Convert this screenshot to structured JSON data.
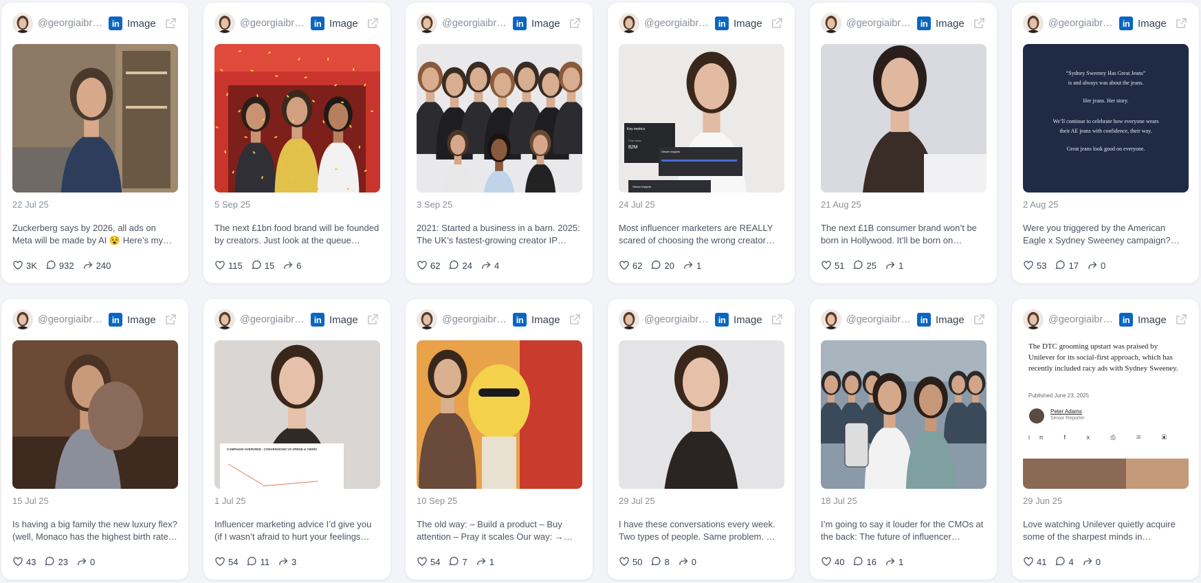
{
  "cards": [
    {
      "handle": "@georgiaibrahim",
      "type": "Image",
      "date": "22 Jul 25",
      "caption": "Zuckerberg says by 2026, all ads on Meta will be made by AI 😵 Here’s my hot take…",
      "likes": "3K",
      "comments": "932",
      "shares": "240"
    },
    {
      "handle": "@georgiaibrahim",
      "type": "Image",
      "date": "5 Sep 25",
      "caption": "The next £1bn food brand will be founded by creators. Just look at the queue…",
      "likes": "115",
      "comments": "15",
      "shares": "6"
    },
    {
      "handle": "@georgiaibrahim",
      "type": "Image",
      "date": "3 Sep 25",
      "caption": "2021: Started a business in a barn. 2025: The UK’s fastest-growing creator IP…",
      "likes": "62",
      "comments": "24",
      "shares": "4"
    },
    {
      "handle": "@georgiaibrahim",
      "type": "Image",
      "date": "24 Jul 25",
      "caption": "Most influencer marketers are REALLY scared of choosing the wrong creator…",
      "likes": "62",
      "comments": "20",
      "shares": "1"
    },
    {
      "handle": "@georgiaibrahim",
      "type": "Image",
      "date": "21 Aug 25",
      "caption": "The next £1B consumer brand won’t be born in Hollywood. It’ll be born on TikTok…",
      "likes": "51",
      "comments": "25",
      "shares": "1"
    },
    {
      "handle": "@georgiaibrahim",
      "type": "Image",
      "date": "2 Aug 25",
      "caption": "Were you triggered by the American Eagle x Sydney Sweeney campaign? Jus…",
      "likes": "53",
      "comments": "17",
      "shares": "0"
    },
    {
      "handle": "@georgiaibrahim",
      "type": "Image",
      "date": "15 Jul 25",
      "caption": "Is having a big family the new luxury flex? (well, Monaco has the highest birth rate…",
      "likes": "43",
      "comments": "23",
      "shares": "0"
    },
    {
      "handle": "@georgiaibrahim",
      "type": "Image",
      "date": "1 Jul 25",
      "caption": "Influencer marketing advice I’d give you (if I wasn’t afraid to hurt your feelings 🥰…",
      "likes": "54",
      "comments": "11",
      "shares": "3"
    },
    {
      "handle": "@georgiaibrahim",
      "type": "Image",
      "date": "10 Sep 25",
      "caption": "The old way: – Build a product – Buy attention – Pray it scales Our way: → Sta…",
      "likes": "54",
      "comments": "7",
      "shares": "1"
    },
    {
      "handle": "@georgiaibrahim",
      "type": "Image",
      "date": "29 Jul 25",
      "caption": "I have these conversations every week. Two types of people. Same problem. → …",
      "likes": "50",
      "comments": "8",
      "shares": "0"
    },
    {
      "handle": "@georgiaibrahim",
      "type": "Image",
      "date": "18 Jul 25",
      "caption": "I’m going to say it louder for the CMOs at the back: The future of influencer…",
      "likes": "40",
      "comments": "16",
      "shares": "1"
    },
    {
      "handle": "@georgiaibrahim",
      "type": "Image",
      "date": "29 Jun 25",
      "caption": "Love watching Unilever quietly acquire some of the sharpest minds in influence…",
      "likes": "41",
      "comments": "4",
      "shares": "0"
    }
  ],
  "thumb_text": {
    "sweeney": [
      "“Sydney Sweeney Has Great Jeans”",
      "is and always was about the jeans.",
      "Her jeans. Her story.",
      "We’ll continue to celebrate how everyone wears",
      "their AE jeans with confidence, their way.",
      "Great jeans look good on everyone."
    ],
    "metrics": {
      "title": "Key metrics",
      "post_views_label": "Post views",
      "post_views": "82M",
      "viewer_insights": "Viewer insights"
    },
    "campaign": "CAMPAIGN OVERVIEW - CONVERSIONS VS SPEND & VIEWS",
    "article": {
      "body": "The DTC grooming upstart was praised by Unilever for its social-first approach, which has recently included racy ads with Sydney Sweeney.",
      "published": "Published June 23, 2025",
      "author": "Peter Adams",
      "role": "Senior Reporter"
    }
  },
  "colors": {
    "linkedin": "#0a66c2",
    "card_bg": "#ffffff",
    "page_bg": "#f3f4f8"
  }
}
